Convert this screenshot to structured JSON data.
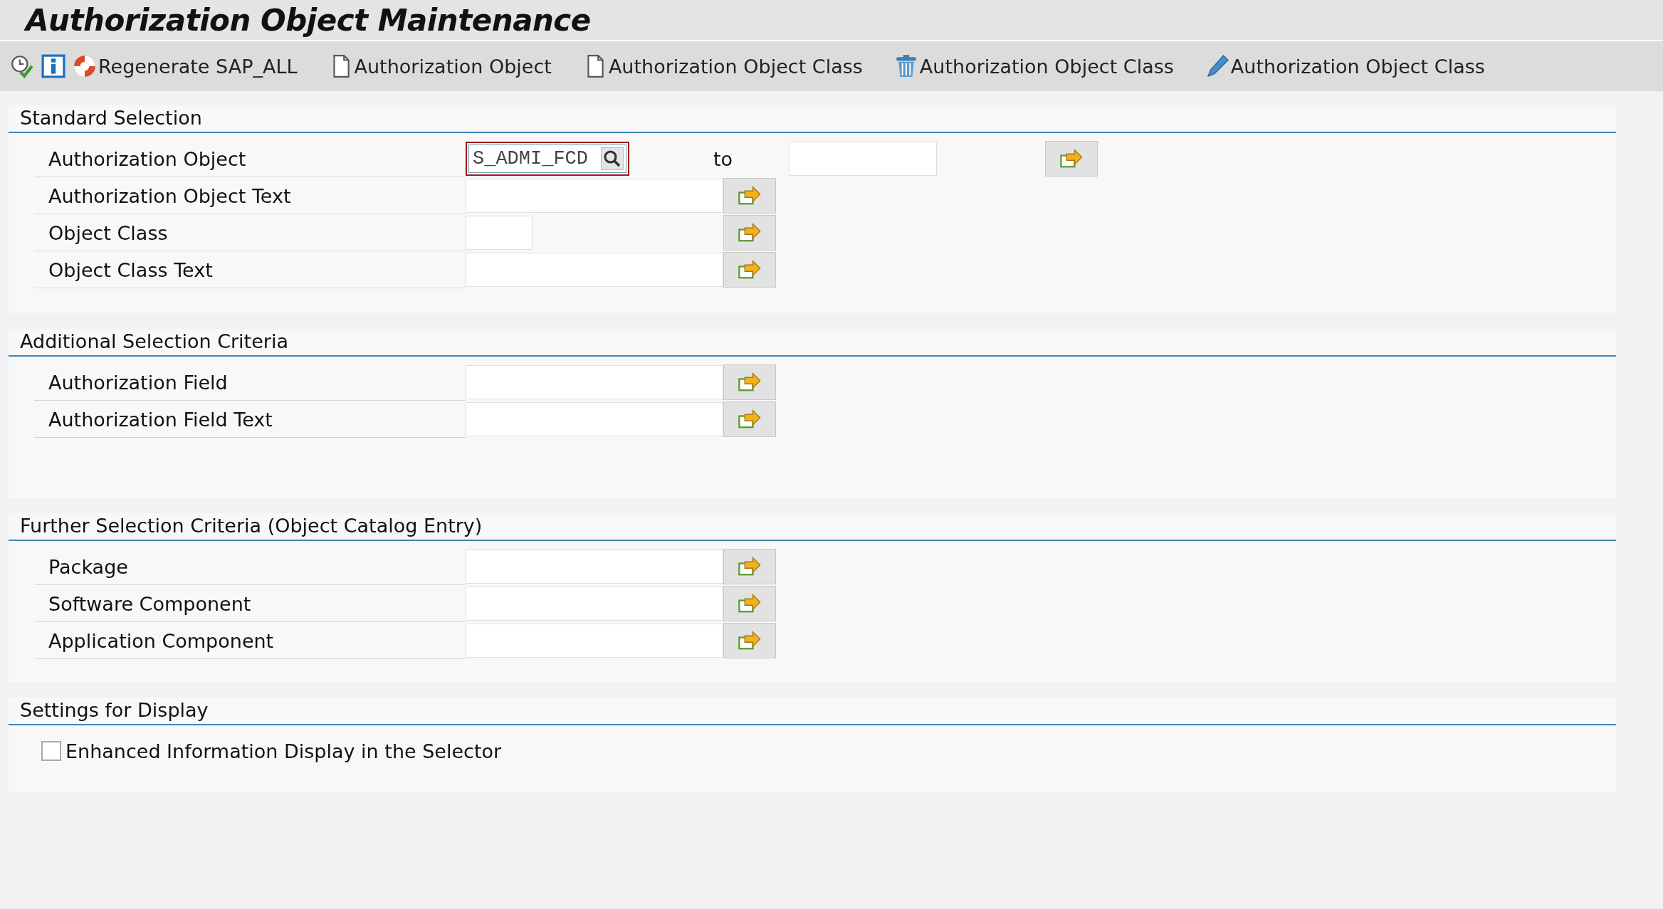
{
  "title": "Authorization Object Maintenance",
  "toolbar": [
    {
      "kind": "check-clock"
    },
    {
      "kind": "info"
    },
    {
      "kind": "regenerate",
      "label": "Regenerate SAP_ALL"
    },
    {
      "kind": "new",
      "label": "Authorization Object"
    },
    {
      "kind": "new",
      "label": "Authorization Object Class"
    },
    {
      "kind": "delete",
      "label": "Authorization Object Class"
    },
    {
      "kind": "edit",
      "label": "Authorization Object Class"
    }
  ],
  "sections": [
    {
      "title": "Standard Selection",
      "rows": [
        {
          "kind": "range",
          "label": "Authorization Object",
          "value": "S_ADMI_FCD",
          "focused": true,
          "to_label": "to"
        },
        {
          "kind": "multi",
          "label": "Authorization Object Text"
        },
        {
          "kind": "multi-short",
          "label": "Object Class"
        },
        {
          "kind": "multi",
          "label": "Object Class Text"
        }
      ]
    },
    {
      "title": "Additional Selection Criteria",
      "rows": [
        {
          "kind": "multi",
          "label": "Authorization Field"
        },
        {
          "kind": "multi",
          "label": "Authorization Field Text"
        }
      ]
    },
    {
      "title": "Further Selection Criteria (Object Catalog Entry)",
      "rows": [
        {
          "kind": "multi",
          "label": "Package"
        },
        {
          "kind": "multi",
          "label": "Software Component"
        },
        {
          "kind": "multi",
          "label": "Application Component"
        }
      ]
    },
    {
      "title": "Settings for Display",
      "rows": [
        {
          "kind": "checkbox",
          "label": "Enhanced Information Display in the Selector",
          "checked": false
        }
      ]
    }
  ]
}
